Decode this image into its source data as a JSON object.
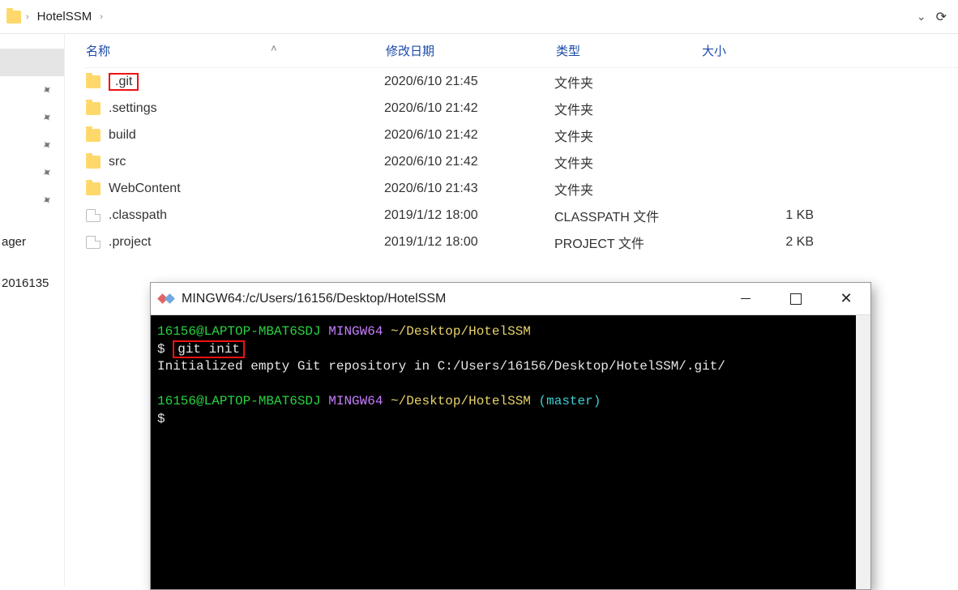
{
  "breadcrumb": {
    "current": "HotelSSM"
  },
  "columns": {
    "name": "名称",
    "modified": "修改日期",
    "type": "类型",
    "size": "大小"
  },
  "files": [
    {
      "name": ".git",
      "modified": "2020/6/10 21:45",
      "type": "文件夹",
      "size": "",
      "icon": "folder",
      "highlight": true
    },
    {
      "name": ".settings",
      "modified": "2020/6/10 21:42",
      "type": "文件夹",
      "size": "",
      "icon": "folder"
    },
    {
      "name": "build",
      "modified": "2020/6/10 21:42",
      "type": "文件夹",
      "size": "",
      "icon": "folder"
    },
    {
      "name": "src",
      "modified": "2020/6/10 21:42",
      "type": "文件夹",
      "size": "",
      "icon": "folder"
    },
    {
      "name": "WebContent",
      "modified": "2020/6/10 21:43",
      "type": "文件夹",
      "size": "",
      "icon": "folder"
    },
    {
      "name": ".classpath",
      "modified": "2019/1/12 18:00",
      "type": "CLASSPATH 文件",
      "size": "1 KB",
      "icon": "file"
    },
    {
      "name": ".project",
      "modified": "2019/1/12 18:00",
      "type": "PROJECT 文件",
      "size": "2 KB",
      "icon": "file"
    }
  ],
  "sidebar": {
    "frag1": "ager",
    "frag2": "2016135"
  },
  "terminal": {
    "title": "MINGW64:/c/Users/16156/Desktop/HotelSSM",
    "prompt_user": "16156@LAPTOP-MBAT6SDJ",
    "prompt_env": "MINGW64",
    "prompt_path": "~/Desktop/HotelSSM",
    "branch": "(master)",
    "ps1": "$",
    "cmd": "git init",
    "output": "Initialized empty Git repository in C:/Users/16156/Desktop/HotelSSM/.git/"
  }
}
